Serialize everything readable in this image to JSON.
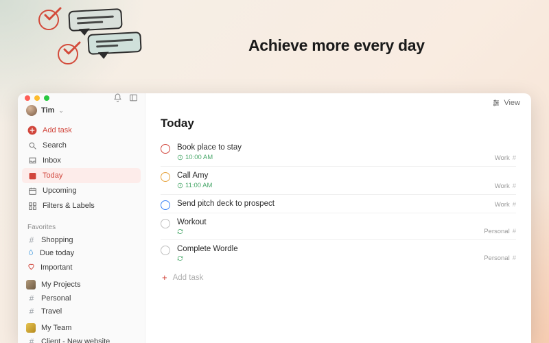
{
  "hero": {
    "headline": "Achieve more every day"
  },
  "user": {
    "name": "Tim"
  },
  "sidebar": {
    "add_task": "Add task",
    "nav": {
      "search": "Search",
      "inbox": "Inbox",
      "today": "Today",
      "upcoming": "Upcoming",
      "filters": "Filters & Labels"
    },
    "favorites_title": "Favorites",
    "favorites": [
      {
        "label": "Shopping",
        "color": "#9aa0a6"
      },
      {
        "label": "Due today",
        "color": "#5aa6e0"
      },
      {
        "label": "Important",
        "color": "#d1453b"
      }
    ],
    "projects_title": "My Projects",
    "projects": [
      {
        "label": "Personal",
        "color": "#9aa0a6"
      },
      {
        "label": "Travel",
        "color": "#9aa0a6"
      }
    ],
    "team_title": "My Team",
    "team": [
      {
        "label": "Client - New website",
        "color": "#9aa0a6"
      }
    ]
  },
  "main": {
    "view_label": "View",
    "title": "Today",
    "tasks": [
      {
        "title": "Book place to stay",
        "time": "10:00 AM",
        "priority": "red",
        "project": "Work",
        "recurring": false
      },
      {
        "title": "Call Amy",
        "time": "11:00 AM",
        "priority": "amber",
        "project": "Work",
        "recurring": false
      },
      {
        "title": "Send pitch deck to prospect",
        "time": "",
        "priority": "blue",
        "project": "Work",
        "recurring": false
      },
      {
        "title": "Workout",
        "time": "",
        "priority": "grey",
        "project": "Personal",
        "recurring": true
      },
      {
        "title": "Complete Wordle",
        "time": "",
        "priority": "grey",
        "project": "Personal",
        "recurring": true
      }
    ],
    "add_task": "Add task"
  },
  "colors": {
    "accent": "#d1453b",
    "green": "#4aa86b"
  }
}
